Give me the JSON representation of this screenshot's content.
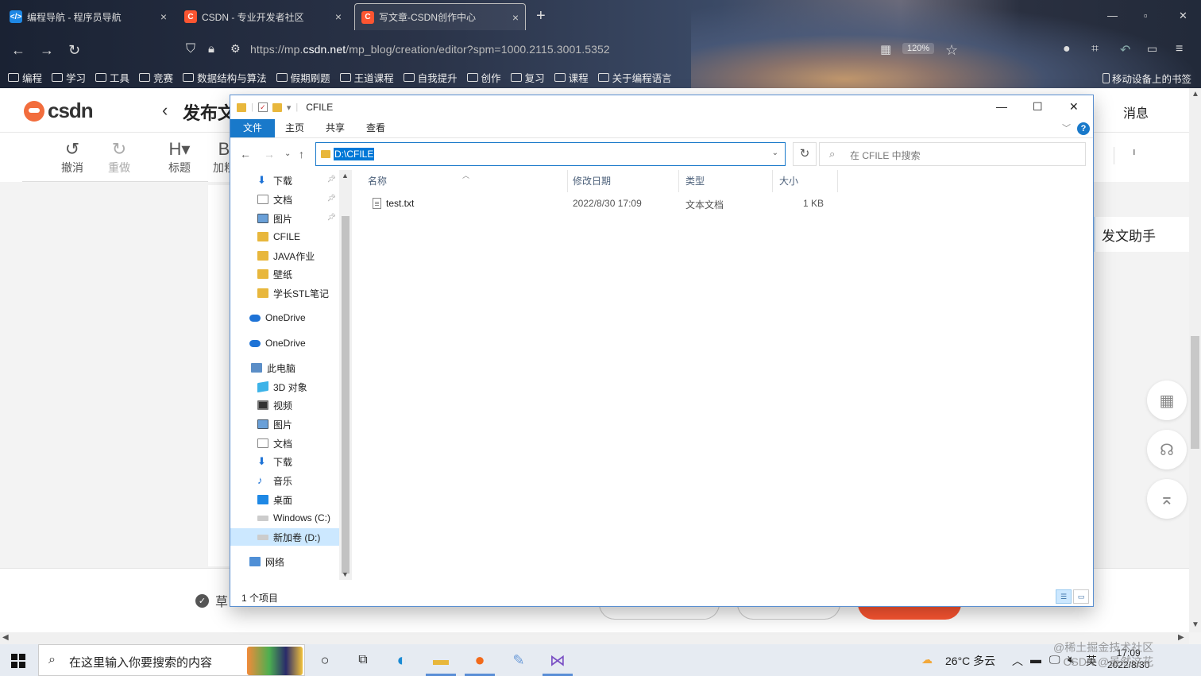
{
  "browser": {
    "tabs": [
      {
        "title": "编程导航 - 程序员导航",
        "favicon_color": "#1e88e5",
        "favicon": "</>"
      },
      {
        "title": "CSDN - 专业开发者社区",
        "favicon_color": "#fc5531",
        "favicon": "C"
      },
      {
        "title": "写文章-CSDN创作中心",
        "favicon_color": "#fc5531",
        "favicon": "C",
        "active": true
      }
    ],
    "url_prefix": "https://mp.",
    "url_domain": "csdn.net",
    "url_suffix": "/mp_blog/creation/editor?spm=1000.2115.3001.5352",
    "zoom": "120%",
    "bookmarks": [
      "编程",
      "学习",
      "工具",
      "竞赛",
      "数据结构与算法",
      "假期刷题",
      "王道课程",
      "自我提升",
      "创作",
      "复习",
      "课程",
      "关于编程语言"
    ],
    "mobile_bookmarks": "移动设备上的书签"
  },
  "csdn": {
    "logo": "csdn",
    "publish_title": "发布文",
    "messages": "消息",
    "tools": [
      {
        "icon": "↺",
        "label": "撤消"
      },
      {
        "icon": "↻",
        "label": "重做"
      },
      {
        "icon": "H▾",
        "label": "标题"
      },
      {
        "icon": "B",
        "label": "加粗"
      }
    ],
    "assistant": "发文助手",
    "draft_label": "草",
    "scroll_indicator": "ı"
  },
  "explorer": {
    "title": "CFILE",
    "ribbon_tabs": [
      "文件",
      "主页",
      "共享",
      "查看"
    ],
    "address": "D:\\CFILE",
    "search_placeholder": "在 CFILE 中搜索",
    "nav_items": [
      {
        "label": "下载",
        "icon": "down",
        "pinned": true
      },
      {
        "label": "文档",
        "icon": "doc",
        "pinned": true
      },
      {
        "label": "图片",
        "icon": "pic",
        "pinned": true
      },
      {
        "label": "CFILE",
        "icon": "fold"
      },
      {
        "label": "JAVA作业",
        "icon": "fold"
      },
      {
        "label": "壁纸",
        "icon": "fold"
      },
      {
        "label": "学长STL笔记",
        "icon": "fold"
      },
      {
        "label": "OneDrive",
        "icon": "cloud"
      },
      {
        "label": "OneDrive",
        "icon": "cloud"
      },
      {
        "label": "此电脑",
        "icon": "pc"
      },
      {
        "label": "3D 对象",
        "icon": "cube"
      },
      {
        "label": "视频",
        "icon": "film"
      },
      {
        "label": "图片",
        "icon": "pic"
      },
      {
        "label": "文档",
        "icon": "doc"
      },
      {
        "label": "下载",
        "icon": "down"
      },
      {
        "label": "音乐",
        "icon": "music"
      },
      {
        "label": "桌面",
        "icon": "desk"
      },
      {
        "label": "Windows (C:)",
        "icon": "drive"
      },
      {
        "label": "新加卷 (D:)",
        "icon": "drive",
        "selected": true
      },
      {
        "label": "网络",
        "icon": "net"
      }
    ],
    "columns": [
      "名称",
      "修改日期",
      "类型",
      "大小"
    ],
    "files": [
      {
        "name": "test.txt",
        "modified": "2022/8/30 17:09",
        "type": "文本文档",
        "size": "1 KB"
      }
    ],
    "status": "1 个项目"
  },
  "taskbar": {
    "search_placeholder": "在这里输入你要搜索的内容",
    "weather": "26°C 多云",
    "ime": "英",
    "time": "17:09",
    "date": "2022/8/30"
  },
  "watermark": {
    "line1": "@稀土掘金技术社区",
    "line2": "CSDN @虽然这花"
  }
}
